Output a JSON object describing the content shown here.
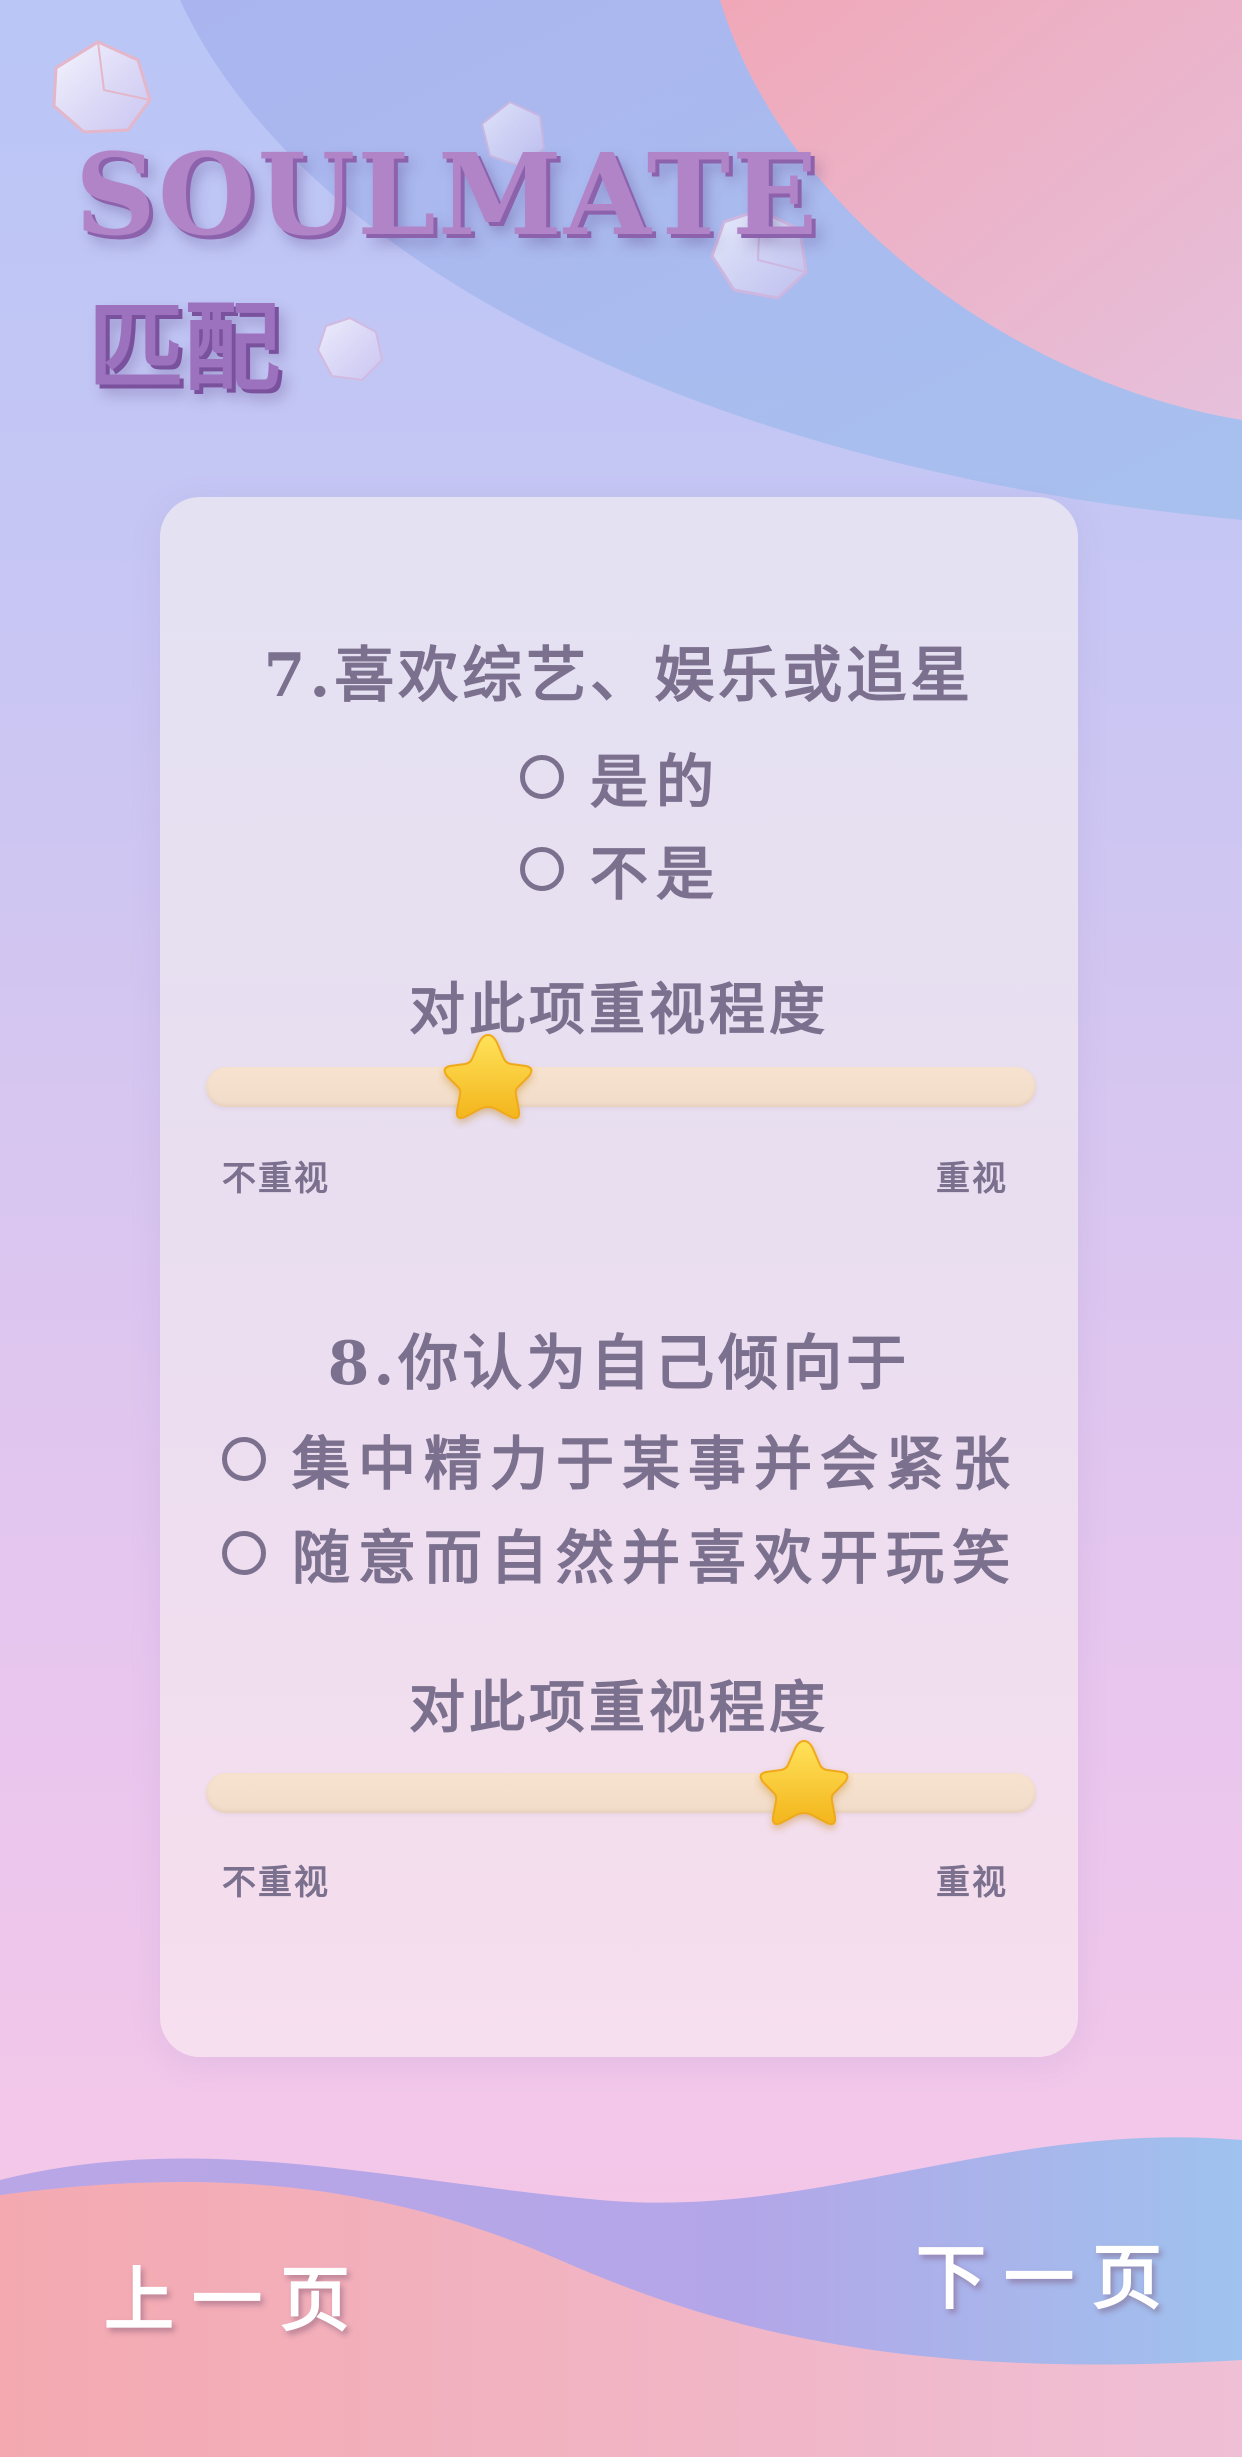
{
  "header": {
    "title": "SOULMATE",
    "subtitle": "匹配"
  },
  "questions": [
    {
      "title": "7.喜欢综艺、娱乐或追星",
      "options": [
        "是的",
        "不是"
      ],
      "importance_label": "对此项重视程度",
      "slider": {
        "min_label": "不重视",
        "max_label": "重视",
        "value": 0.34
      }
    },
    {
      "title": "8.你认为自己倾向于",
      "options": [
        "集中精力于某事并会紧张",
        "随意而自然并喜欢开玩笑"
      ],
      "importance_label": "对此项重视程度",
      "slider": {
        "min_label": "不重视",
        "max_label": "重视",
        "value": 0.72
      }
    }
  ],
  "nav": {
    "prev_label": "上一页",
    "next_label": "下一页"
  },
  "colors": {
    "text": "#7b708e",
    "title": "#b184c8",
    "star": "#f8c72a",
    "track": "#f3dfcc"
  },
  "icons": [
    "star-icon",
    "radio-circle-icon",
    "crystal-icon"
  ]
}
